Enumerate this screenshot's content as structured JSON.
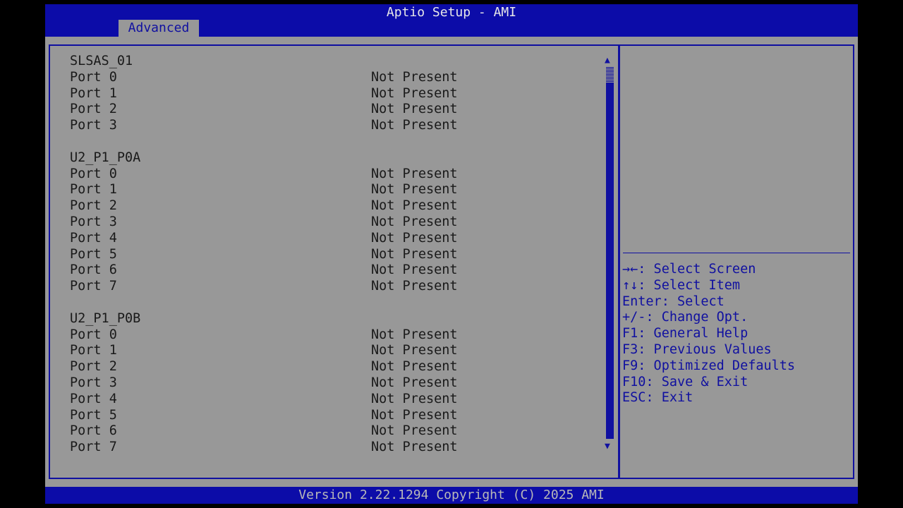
{
  "header": {
    "title": "Aptio Setup - AMI",
    "tab": "Advanced"
  },
  "groups": [
    {
      "name": "SLSAS_01",
      "ports": [
        [
          "Port 0",
          "Not Present"
        ],
        [
          "Port 1",
          "Not Present"
        ],
        [
          "Port 2",
          "Not Present"
        ],
        [
          "Port 3",
          "Not Present"
        ]
      ]
    },
    {
      "name": "U2_P1_P0A",
      "ports": [
        [
          "Port 0",
          "Not Present"
        ],
        [
          "Port 1",
          "Not Present"
        ],
        [
          "Port 2",
          "Not Present"
        ],
        [
          "Port 3",
          "Not Present"
        ],
        [
          "Port 4",
          "Not Present"
        ],
        [
          "Port 5",
          "Not Present"
        ],
        [
          "Port 6",
          "Not Present"
        ],
        [
          "Port 7",
          "Not Present"
        ]
      ]
    },
    {
      "name": "U2_P1_P0B",
      "ports": [
        [
          "Port 0",
          "Not Present"
        ],
        [
          "Port 1",
          "Not Present"
        ],
        [
          "Port 2",
          "Not Present"
        ],
        [
          "Port 3",
          "Not Present"
        ],
        [
          "Port 4",
          "Not Present"
        ],
        [
          "Port 5",
          "Not Present"
        ],
        [
          "Port 6",
          "Not Present"
        ],
        [
          "Port 7",
          "Not Present"
        ]
      ]
    }
  ],
  "help": [
    "→←: Select Screen",
    "↑↓: Select Item",
    "Enter: Select",
    "+/-: Change Opt.",
    "F1: General Help",
    "F3: Previous Values",
    "F9: Optimized Defaults",
    "F10: Save & Exit",
    "ESC: Exit"
  ],
  "footer": "Version 2.22.1294 Copyright (C) 2025 AMI"
}
